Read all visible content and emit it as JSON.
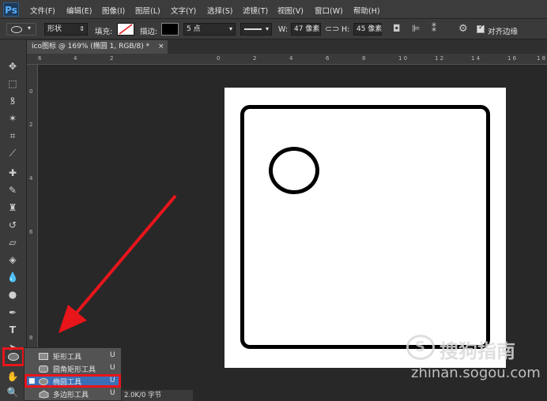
{
  "app": {
    "logo": "Ps"
  },
  "menu": [
    "文件(F)",
    "编辑(E)",
    "图像(I)",
    "图层(L)",
    "文字(Y)",
    "选择(S)",
    "滤镜(T)",
    "视图(V)",
    "窗口(W)",
    "帮助(H)"
  ],
  "options": {
    "mode": "形状",
    "fill_label": "填充:",
    "stroke_label": "描边:",
    "stroke_size": "5 点",
    "w_label": "W:",
    "w_value": "47 像素",
    "link_icon": "link-icon",
    "h_label": "H:",
    "h_value": "45 像素",
    "align_edges_label": "对齐边缘"
  },
  "document_tab": {
    "title": "ico图标 @ 169% (椭圆 1, RGB/8) *",
    "close": "×"
  },
  "ruler_top": [
    "6",
    "4",
    "2",
    "0",
    "2",
    "4",
    "6",
    "8",
    "1 0",
    "1 2",
    "1 4",
    "1 6",
    "1 8"
  ],
  "ruler_left": [
    "0",
    "2",
    "4",
    "6",
    "8"
  ],
  "flyout": {
    "items": [
      {
        "label": "矩形工具",
        "key": "U",
        "icon": "rectangle-icon"
      },
      {
        "label": "圆角矩形工具",
        "key": "U",
        "icon": "rounded-rectangle-icon"
      },
      {
        "label": "椭圆工具",
        "key": "U",
        "icon": "ellipse-icon"
      },
      {
        "label": "多边形工具",
        "key": "U",
        "icon": "polygon-icon"
      }
    ],
    "selected_index": 2
  },
  "statusbar": {
    "text": "2.0K/0 字节"
  },
  "watermark": {
    "brand": "搜狗指南",
    "url": "zhinan.sogou.com"
  },
  "colors": {
    "highlight": "#e8151b",
    "arrow": "#e8151b",
    "canvas": "#ffffff"
  }
}
